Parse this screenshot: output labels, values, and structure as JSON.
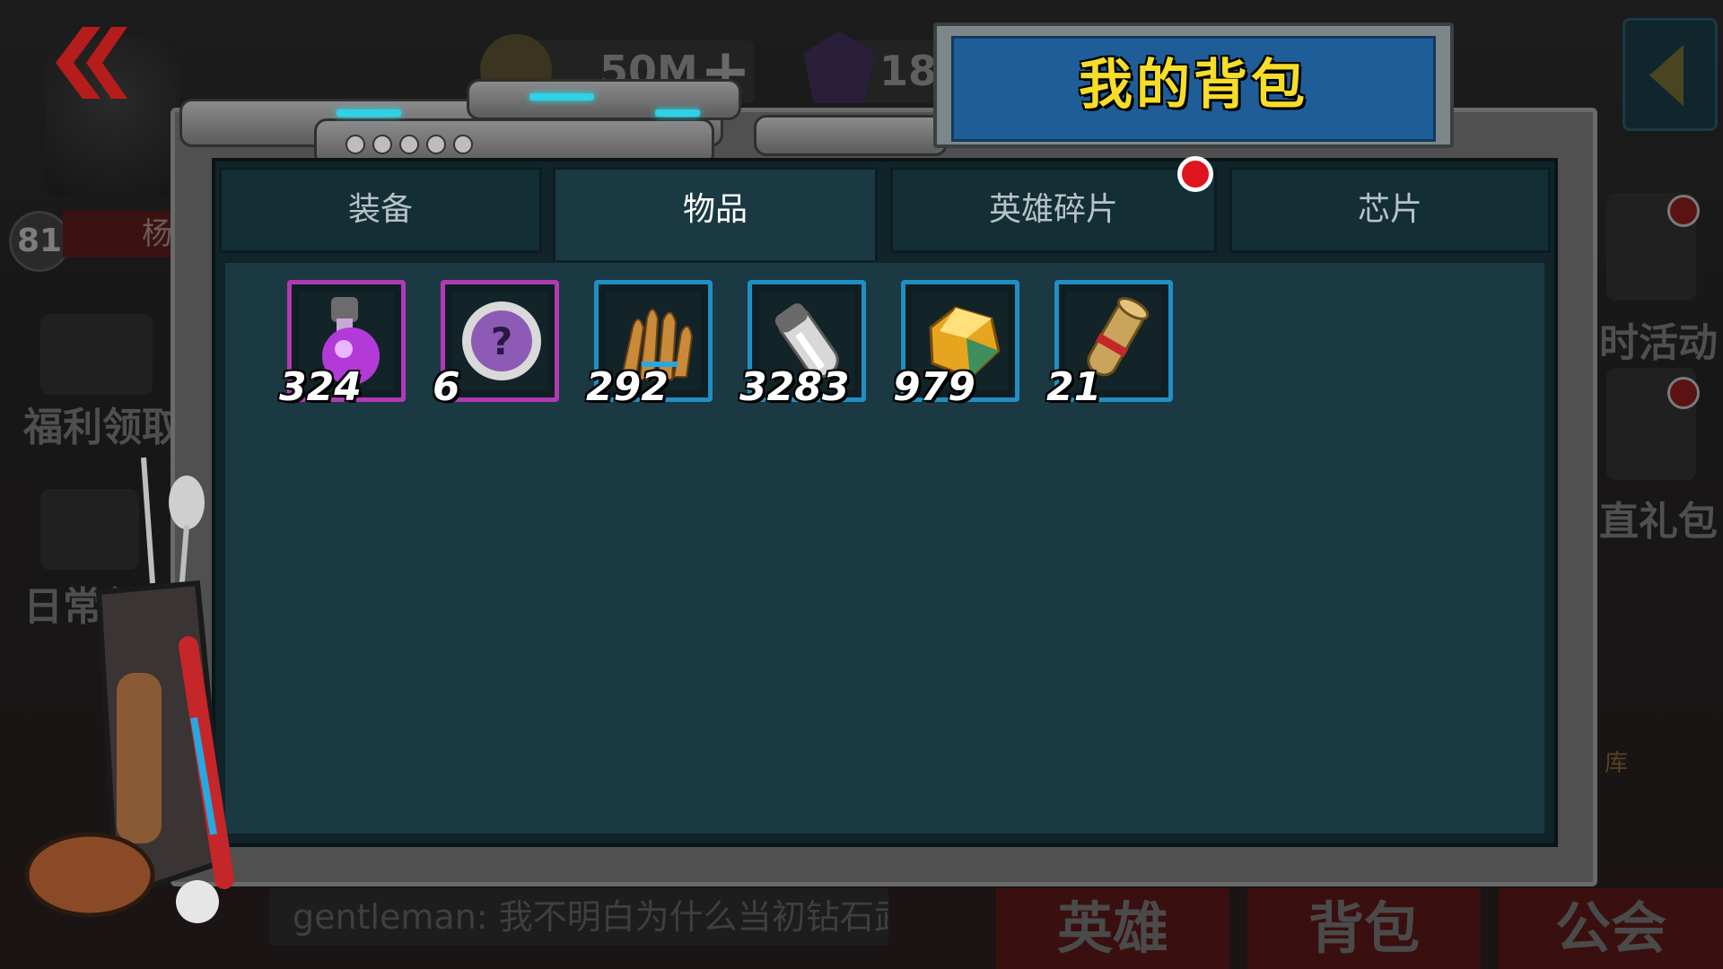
{
  "background": {
    "currency_amount": "50M",
    "gem_amount": "18",
    "player_level": "81",
    "player_name": "杨",
    "side_left": [
      "福利领取",
      "日常任"
    ],
    "side_right": [
      "时活动",
      "直礼包",
      "库"
    ],
    "chat": {
      "user": "gentleman:",
      "message": "我不明白为什么当初钻石武"
    },
    "bottom_nav": [
      "英雄",
      "背包",
      "公会"
    ]
  },
  "modal": {
    "title": "我的背包",
    "tabs": [
      {
        "label": "装备",
        "active": false
      },
      {
        "label": "物品",
        "active": true
      },
      {
        "label": "英雄碎片",
        "active": false,
        "notification": true
      },
      {
        "label": "芯片",
        "active": false
      }
    ],
    "items": [
      {
        "icon": "purple-potion-icon",
        "count": "324",
        "rarity": "purple"
      },
      {
        "icon": "mystery-chip-icon",
        "count": "6",
        "rarity": "purple"
      },
      {
        "icon": "bullets-icon",
        "count": "292",
        "rarity": "blue"
      },
      {
        "icon": "silver-vial-icon",
        "count": "3283",
        "rarity": "blue"
      },
      {
        "icon": "gold-crystal-icon",
        "count": "979",
        "rarity": "blue"
      },
      {
        "icon": "scroll-icon",
        "count": "21",
        "rarity": "blue"
      }
    ]
  },
  "colors": {
    "title_text": "#f5dd2a",
    "title_plate": "#1f5d98",
    "panel": "#1b3942",
    "rarity_purple": "#b03ab6",
    "rarity_blue": "#1f8fc4",
    "notification": "#e0141b"
  }
}
